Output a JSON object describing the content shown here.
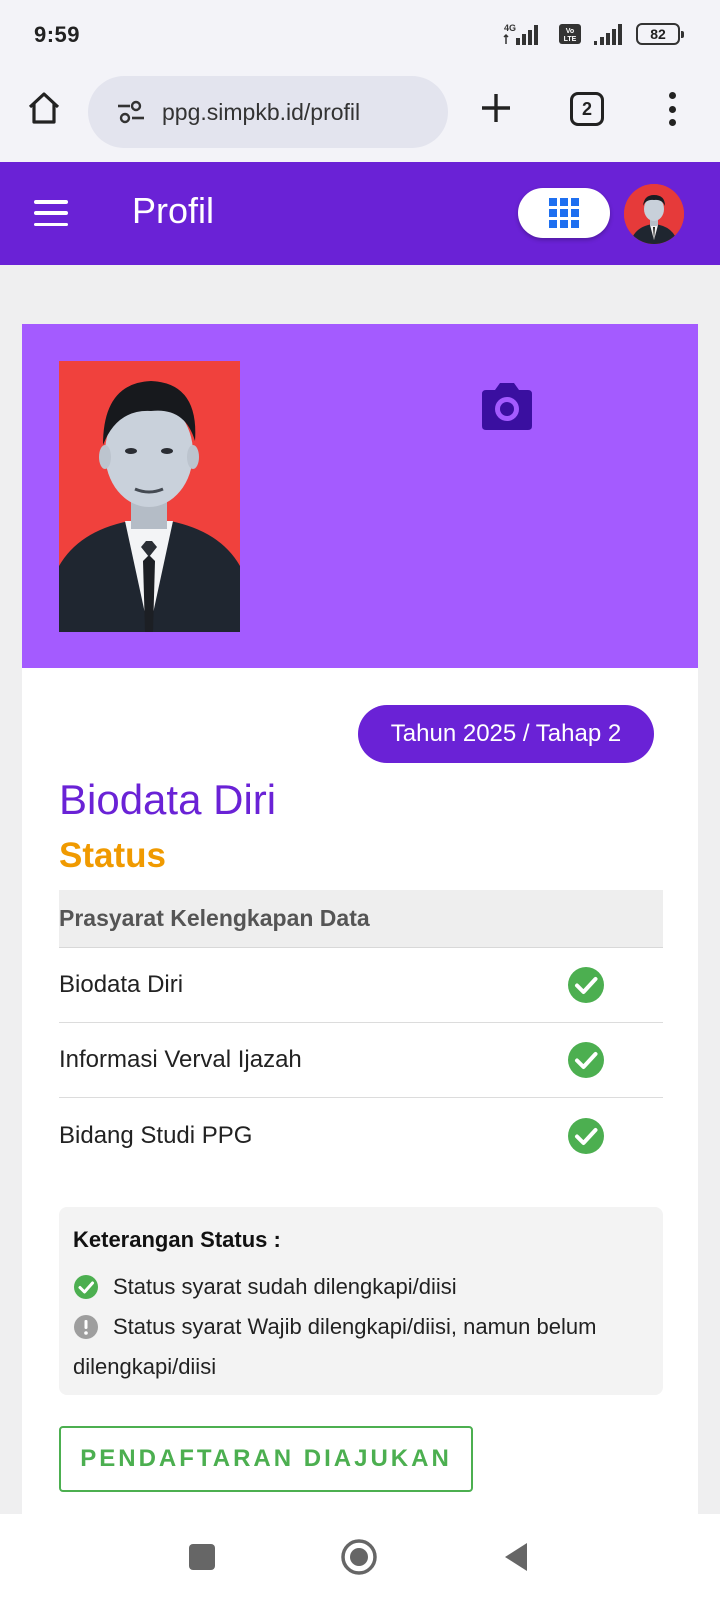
{
  "status_bar": {
    "time": "9:59",
    "network": "4G",
    "volte": "VoLTE",
    "battery": "82"
  },
  "browser": {
    "url": "ppg.simpkb.id/profil",
    "tab_count": "2"
  },
  "app_bar": {
    "title": "Profil"
  },
  "profile": {
    "period_badge": "Tahun 2025 / Tahap 2",
    "section_title": "Biodata Diri",
    "status_title": "Status",
    "requirements_header": "Prasyarat Kelengkapan Data",
    "requirements": [
      {
        "label": "Biodata Diri",
        "status": "complete"
      },
      {
        "label": "Informasi Verval Ijazah",
        "status": "complete"
      },
      {
        "label": "Bidang Studi PPG",
        "status": "complete"
      }
    ],
    "legend": {
      "title": "Keterangan Status :",
      "complete_text": "Status syarat sudah dilengkapi/diisi",
      "pending_text": "Status syarat Wajib dilengkapi/diisi, namun belum dilengkapi/diisi"
    },
    "submit_label": "PENDAFTARAN DIAJUKAN"
  },
  "colors": {
    "primary": "#6a22d6",
    "header_bg": "#a45bff",
    "status_orange": "#f09a00",
    "success_green": "#4caf50"
  }
}
